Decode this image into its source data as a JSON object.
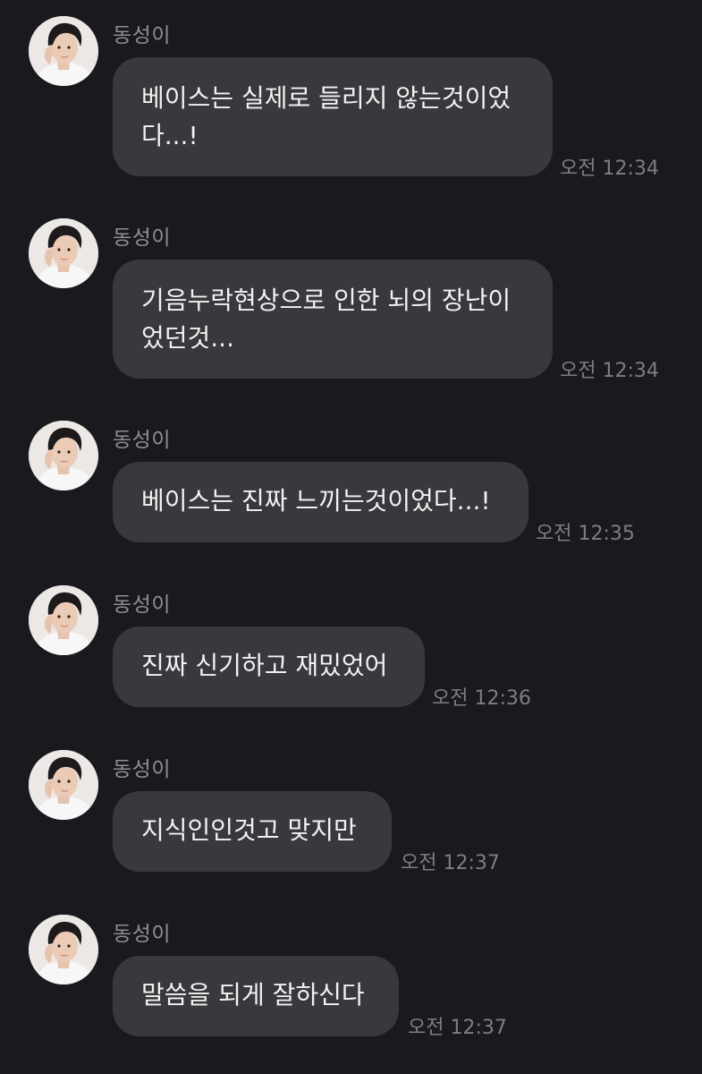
{
  "chat": {
    "messages": [
      {
        "sender": "동성이",
        "text": "베이스는 실제로 들리지 않는것이었\n다...!",
        "time": "오전 12:34"
      },
      {
        "sender": "동성이",
        "text": "기음누락현상으로 인한 뇌의 장난이\n었던것...",
        "time": "오전 12:34"
      },
      {
        "sender": "동성이",
        "text": "베이스는 진짜 느끼는것이었다...!",
        "time": "오전 12:35"
      },
      {
        "sender": "동성이",
        "text": "진짜 신기하고 재밌었어",
        "time": "오전 12:36"
      },
      {
        "sender": "동성이",
        "text": "지식인인것고 맞지만",
        "time": "오전 12:37"
      },
      {
        "sender": "동성이",
        "text": "말씀을 되게 잘하신다",
        "time": "오전 12:37"
      }
    ]
  },
  "colors": {
    "background": "#1a1a1e",
    "bubble": "#38383d",
    "text": "#f2f2f2",
    "meta": "#8e8e93"
  },
  "icons": {
    "avatar": "profile-photo"
  }
}
